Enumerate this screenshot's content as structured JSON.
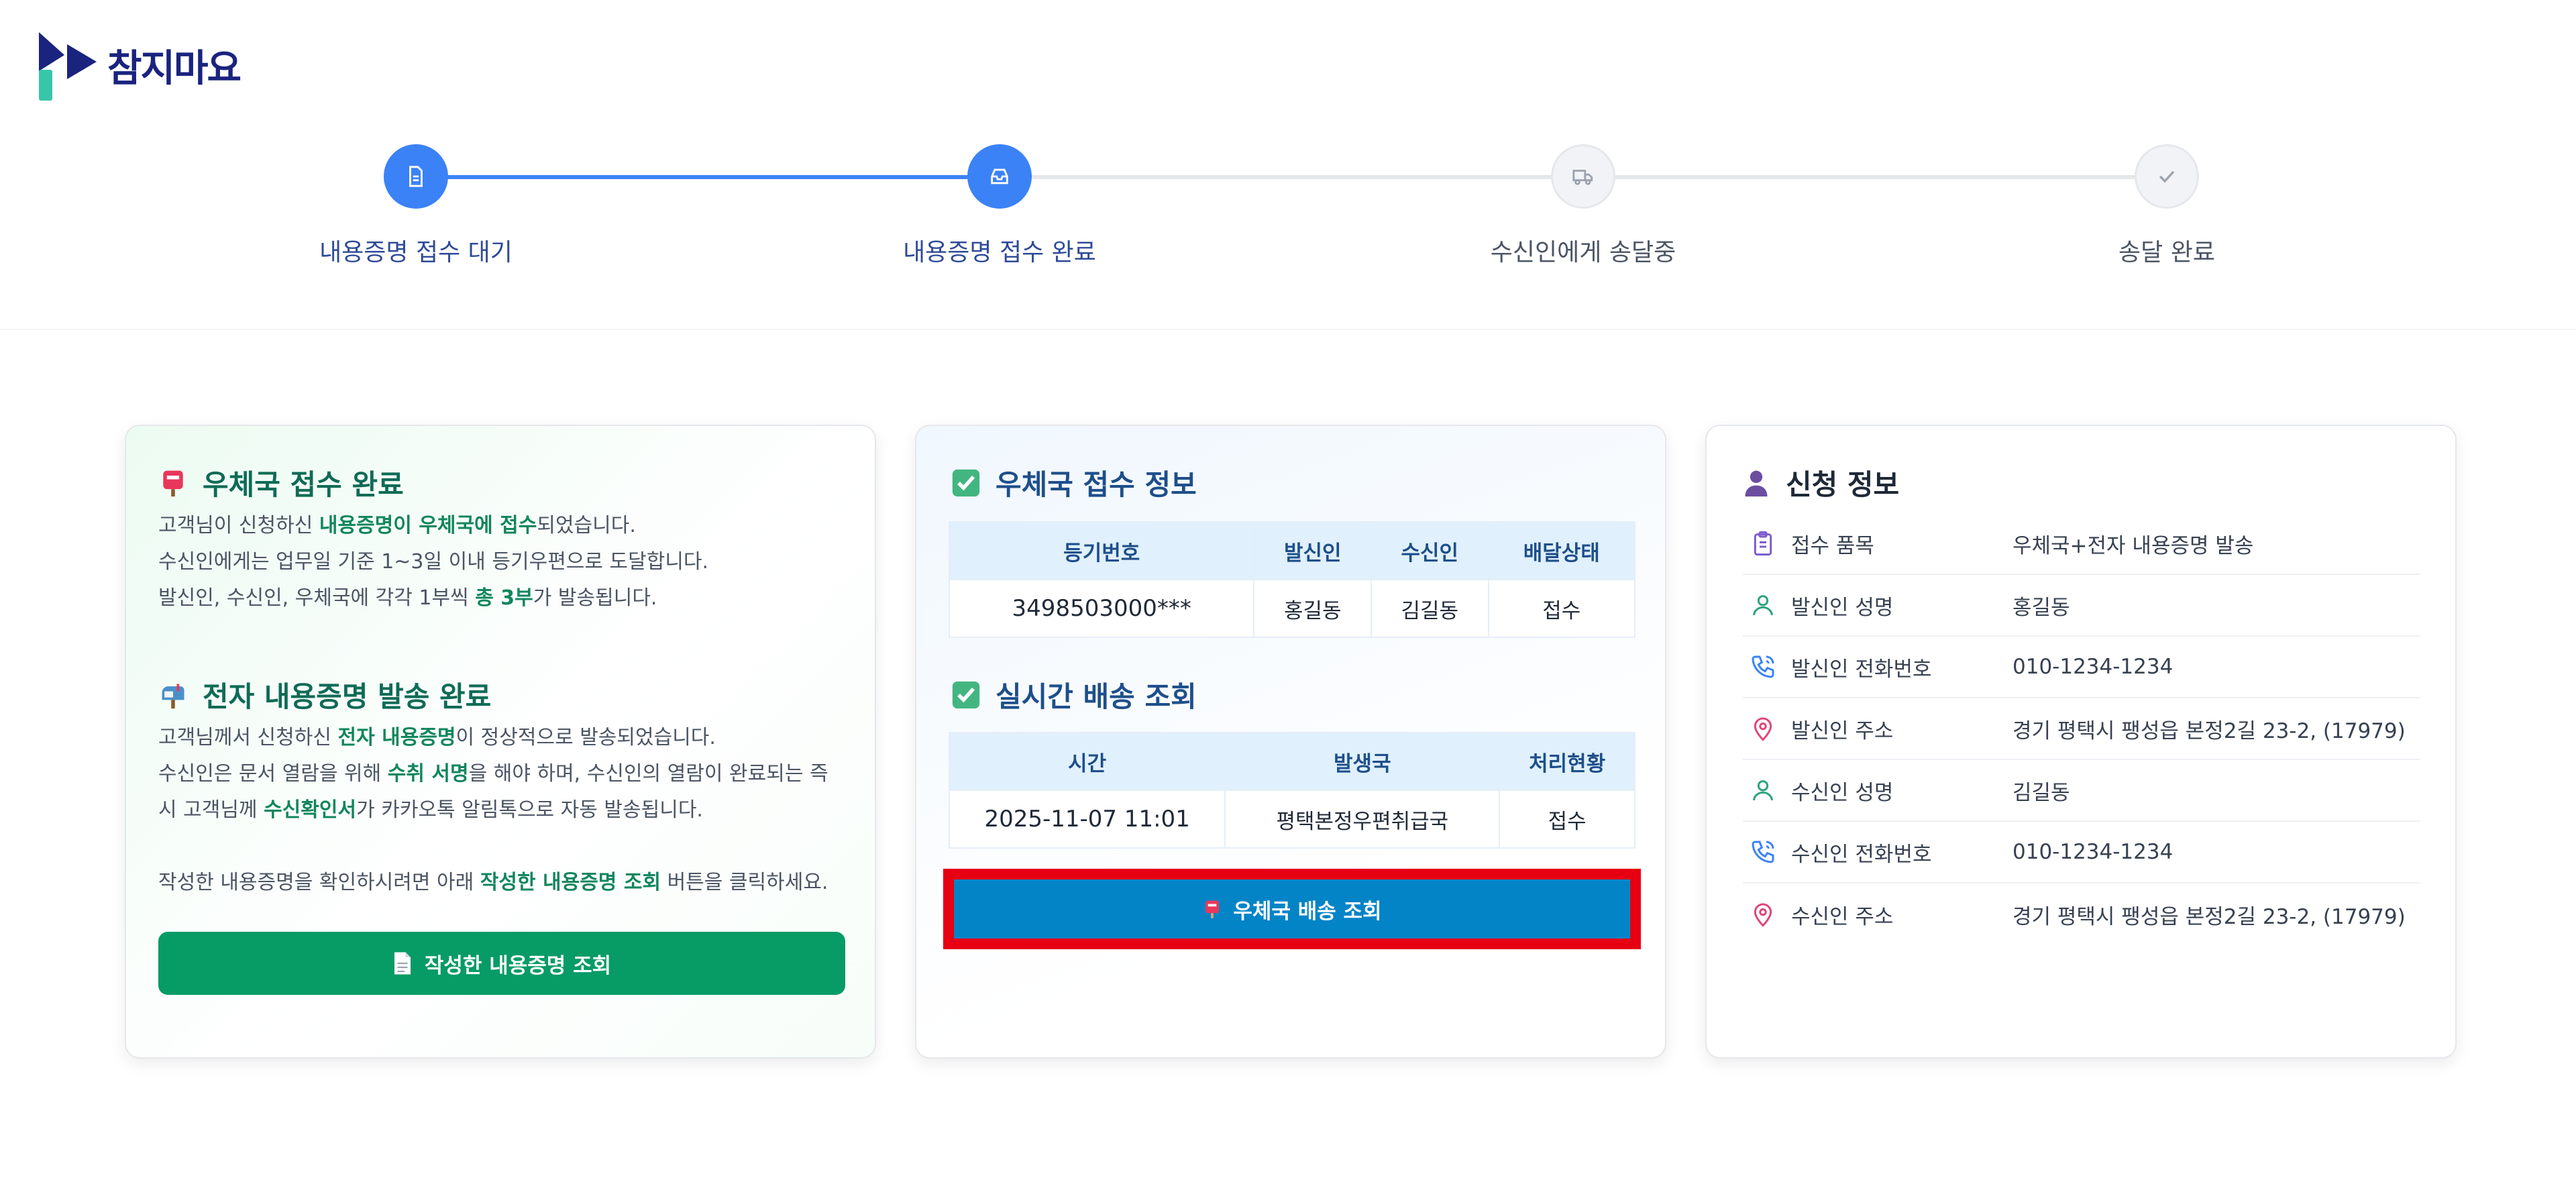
{
  "brand": {
    "name": "참지마요"
  },
  "stepper": {
    "steps": [
      {
        "label": "내용증명 접수 대기",
        "state": "done",
        "icon": "document-icon"
      },
      {
        "label": "내용증명 접수 완료",
        "state": "done",
        "icon": "inbox-icon"
      },
      {
        "label": "수신인에게 송달중",
        "state": "pending",
        "icon": "truck-icon"
      },
      {
        "label": "송달 완료",
        "state": "pending",
        "icon": "check-icon"
      }
    ]
  },
  "card1": {
    "section1": {
      "title": "우체국 접수 완료",
      "icon": "postbox-icon",
      "lines": [
        [
          "고객님이 신청하신 ",
          "내용증명이 우체국에 접수",
          "되었습니다."
        ],
        [
          "수신인에게는 업무일 기준 1~3일 이내 등기우편으로 도달합니다.",
          "",
          ""
        ],
        [
          "발신인, 수신인, 우체국에 각각 1부씩 ",
          "총 3부",
          "가 발송됩니다."
        ]
      ]
    },
    "section2": {
      "title": "전자 내용증명 발송 완료",
      "icon": "mailbox-icon",
      "lines": [
        [
          "고객님께서 신청하신 ",
          "전자 내용증명",
          "이 정상적으로 발송되었습니다."
        ],
        [
          "수신인은 문서 열람을 위해 ",
          "수취 서명",
          "을 해야 하며, 수신인의 열람이 완료되는 즉"
        ],
        [
          "시 고객님께 ",
          "수신확인서",
          "가 카카오톡 알림톡으로 자동 발송됩니다."
        ]
      ]
    },
    "note": [
      "작성한 내용증명을 확인하시려면 아래 ",
      "작성한 내용증명 조회",
      " 버튼을 클릭하세요."
    ],
    "button_label": "작성한 내용증명 조회"
  },
  "card2": {
    "reception": {
      "title": "우체국 접수 정보",
      "headers": [
        "등기번호",
        "발신인",
        "수신인",
        "배달상태"
      ],
      "row": [
        "3498503000***",
        "홍길동",
        "김길동",
        "접수"
      ]
    },
    "tracking": {
      "title": "실시간 배송 조회",
      "headers": [
        "시간",
        "발생국",
        "처리현황"
      ],
      "row": [
        "2025-11-07 11:01",
        "평택본정우편취급국",
        "접수"
      ]
    },
    "button_label": "우체국 배송 조회"
  },
  "card3": {
    "title": "신청 정보",
    "rows": [
      {
        "label": "접수 품목",
        "value": "우체국+전자 내용증명 발송",
        "icon": "clipboard-icon"
      },
      {
        "label": "발신인 성명",
        "value": "홍길동",
        "icon": "user-icon"
      },
      {
        "label": "발신인 전화번호",
        "value": "010-1234-1234",
        "icon": "phone-icon"
      },
      {
        "label": "발신인 주소",
        "value": "경기 평택시 팽성읍 본정2길 23-2, (17979)",
        "icon": "map-pin-icon"
      },
      {
        "label": "수신인 성명",
        "value": "김길동",
        "icon": "user-icon"
      },
      {
        "label": "수신인 전화번호",
        "value": "010-1234-1234",
        "icon": "phone-icon"
      },
      {
        "label": "수신인 주소",
        "value": "경기 평택시 팽성읍 본정2길 23-2, (17979)",
        "icon": "map-pin-icon"
      }
    ]
  },
  "colors": {
    "primary_blue": "#3b82f6",
    "green_button": "#079b66",
    "blue_button": "#0284c7",
    "highlight_red": "#e60012",
    "highlight_text": "#12865e"
  }
}
